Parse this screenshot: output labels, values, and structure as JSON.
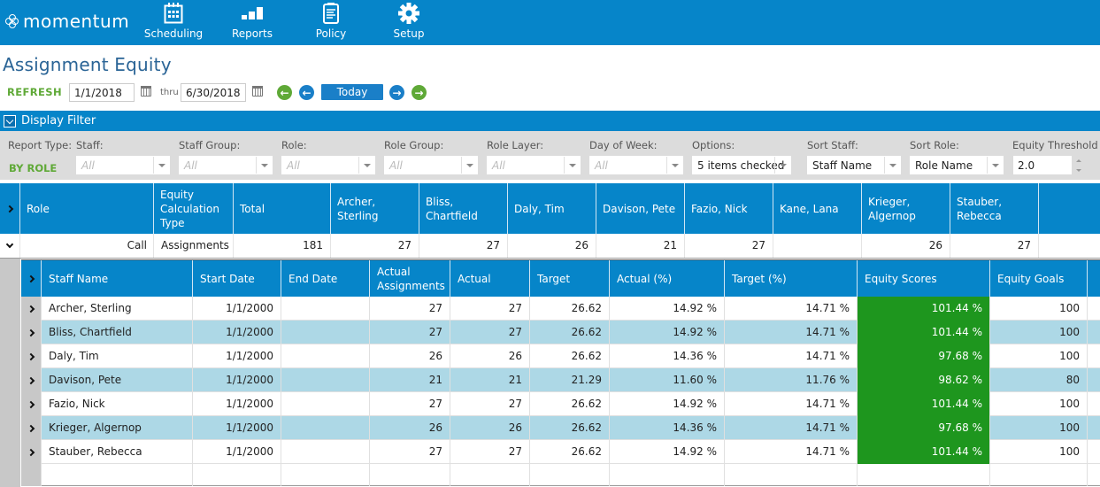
{
  "app": {
    "logo": "momentum",
    "nav": [
      {
        "label": "Scheduling",
        "icon": "calendar-icon"
      },
      {
        "label": "Reports",
        "icon": "bar-chart-icon"
      },
      {
        "label": "Policy",
        "icon": "document-icon"
      },
      {
        "label": "Setup",
        "icon": "gear-icon"
      }
    ]
  },
  "page": {
    "title": "Assignment Equity"
  },
  "toolbar": {
    "refresh_label": "REFRESH",
    "start_date": "1/1/2018",
    "thru_label": "thru",
    "end_date": "6/30/2018",
    "today_label": "Today"
  },
  "filter": {
    "title": "Display Filter",
    "report_type_label": "Report Type:",
    "report_type_value": "BY ROLE",
    "fields": [
      {
        "label": "Staff:",
        "value": "All",
        "placeholder": true
      },
      {
        "label": "Staff Group:",
        "value": "All",
        "placeholder": true
      },
      {
        "label": "Role:",
        "value": "All",
        "placeholder": true
      },
      {
        "label": "Role Group:",
        "value": "All",
        "placeholder": true
      },
      {
        "label": "Role Layer:",
        "value": "All",
        "placeholder": true
      },
      {
        "label": "Day of Week:",
        "value": "All",
        "placeholder": true
      },
      {
        "label": "Options:",
        "value": "5 items checked",
        "placeholder": false
      },
      {
        "label": "Sort Staff:",
        "value": "Staff Name",
        "placeholder": false
      },
      {
        "label": "Sort Role:",
        "value": "Role Name",
        "placeholder": false
      }
    ],
    "threshold_label": "Equity Threshold",
    "threshold_value": "2.0"
  },
  "outer_grid": {
    "headers": [
      "Role",
      "Equity Calculation Type",
      "Total",
      "Archer, Sterling",
      "Bliss, Chartfield",
      "Daly, Tim",
      "Davison, Pete",
      "Fazio, Nick",
      "Kane, Lana",
      "Krieger, Algernop",
      "Stauber, Rebecca",
      ""
    ],
    "row": [
      "Call",
      "Assignments",
      "181",
      "27",
      "27",
      "26",
      "21",
      "27",
      "",
      "26",
      "27",
      ""
    ]
  },
  "inner_grid": {
    "headers": [
      "Staff Name",
      "Start Date",
      "End Date",
      "Actual Assignments",
      "Actual",
      "Target",
      "Actual (%)",
      "Target (%)",
      "Equity Scores",
      "Equity Goals",
      ""
    ],
    "rows": [
      [
        "Archer, Sterling",
        "1/1/2000",
        "",
        "27",
        "27",
        "26.62",
        "14.92 %",
        "14.71 %",
        "101.44 %",
        "100",
        ""
      ],
      [
        "Bliss, Chartfield",
        "1/1/2000",
        "",
        "27",
        "27",
        "26.62",
        "14.92 %",
        "14.71 %",
        "101.44 %",
        "100",
        ""
      ],
      [
        "Daly, Tim",
        "1/1/2000",
        "",
        "26",
        "26",
        "26.62",
        "14.36 %",
        "14.71 %",
        "97.68 %",
        "100",
        ""
      ],
      [
        "Davison, Pete",
        "1/1/2000",
        "",
        "21",
        "21",
        "21.29",
        "11.60 %",
        "11.76 %",
        "98.62 %",
        "80",
        ""
      ],
      [
        "Fazio, Nick",
        "1/1/2000",
        "",
        "27",
        "27",
        "26.62",
        "14.92 %",
        "14.71 %",
        "101.44 %",
        "100",
        ""
      ],
      [
        "Krieger, Algernop",
        "1/1/2000",
        "",
        "26",
        "26",
        "26.62",
        "14.36 %",
        "14.71 %",
        "97.68 %",
        "100",
        ""
      ],
      [
        "Stauber, Rebecca",
        "1/1/2000",
        "",
        "27",
        "27",
        "26.62",
        "14.92 %",
        "14.71 %",
        "101.44 %",
        "100",
        ""
      ]
    ]
  },
  "colors": {
    "brand": "#0685c9",
    "accent_green": "#5fa937",
    "score_good": "#1e961e",
    "alt_row": "#add8e6"
  }
}
